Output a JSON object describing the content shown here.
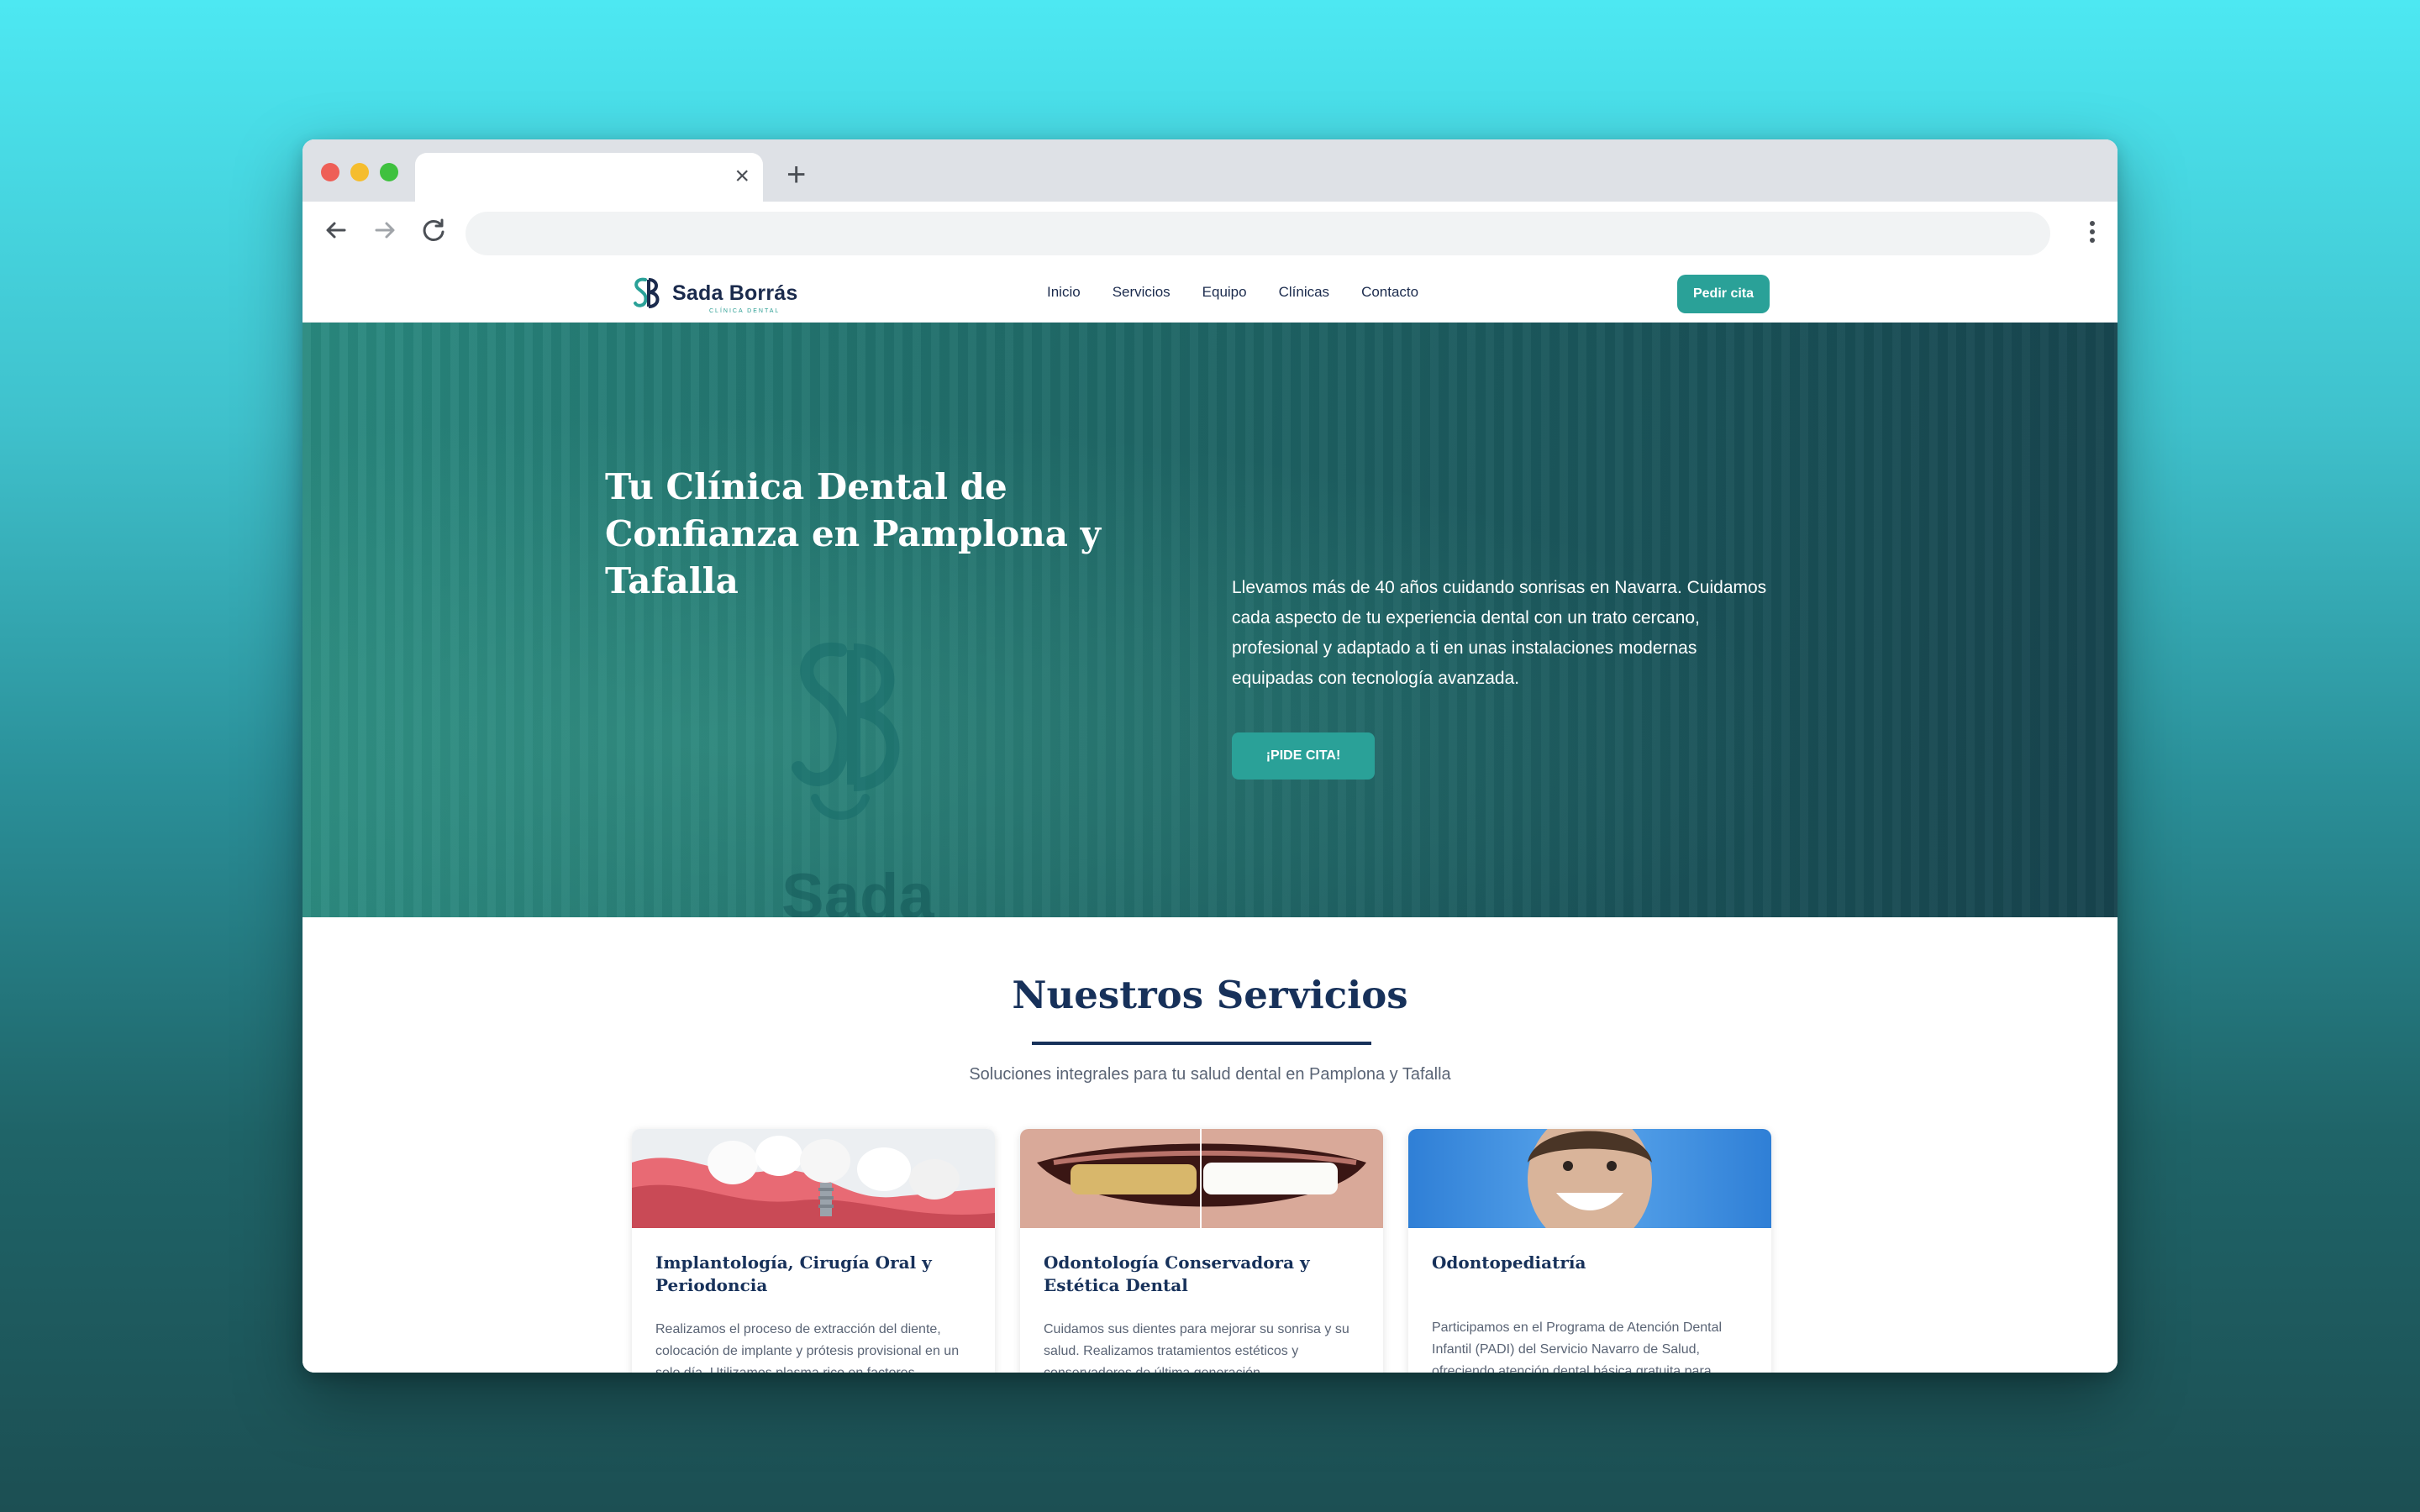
{
  "browser": {
    "tab_close": "×",
    "new_tab": "+"
  },
  "site": {
    "logo": {
      "name": "Sada Borrás",
      "subtitle": "CLÍNICA DENTAL",
      "monogram": "SB"
    },
    "nav": [
      "Inicio",
      "Servicios",
      "Equipo",
      "Clínicas",
      "Contacto"
    ],
    "header_cta": "Pedir cita"
  },
  "hero": {
    "title": "Tu Clínica Dental de Confianza en Pamplona y Tafalla",
    "text": "Llevamos más de 40 años cuidando sonrisas en Navarra. Cuidamos cada aspecto de tu experiencia dental con un trato cercano, profesional y adaptado a ti en unas instalaciones modernas equipadas con tecnología avanzada.",
    "cta": "¡PIDE CITA!",
    "sign_text": "Sada"
  },
  "services": {
    "title": "Nuestros Servicios",
    "subtitle": "Soluciones integrales para tu salud dental en Pamplona y Tafalla",
    "cards": [
      {
        "title": "Implantología, Cirugía Oral y Periodoncia",
        "text": "Realizamos el proceso de extracción del diente, colocación de implante y prótesis provisional en un solo día. Utilizamos plasma rico en factores"
      },
      {
        "title": "Odontología Conservadora y Estética Dental",
        "text": "Cuidamos sus dientes para mejorar su sonrisa y su salud. Realizamos tratamientos estéticos y conservadores de última generación."
      },
      {
        "title": "Odontopediatría",
        "text": "Participamos en el Programa de Atención Dental Infantil (PADI) del Servicio Navarro de Salud, ofreciendo atención dental básica gratuita para"
      }
    ]
  },
  "colors": {
    "accent": "#2aa198",
    "navy": "#17315a",
    "hero_teal": "#237671"
  }
}
